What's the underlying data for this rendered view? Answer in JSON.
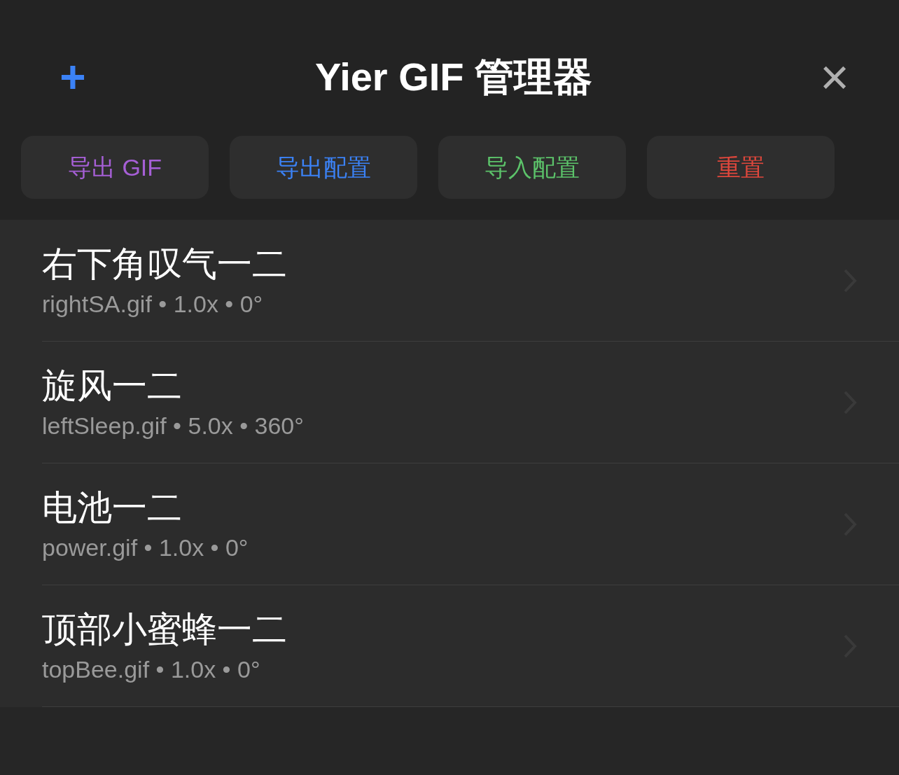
{
  "header": {
    "add_button": "+",
    "title": "Yier GIF 管理器",
    "close_button": "×"
  },
  "actions": [
    {
      "label": "导出 GIF",
      "color": "#a65fd6"
    },
    {
      "label": "导出配置",
      "color": "#3b82f6"
    },
    {
      "label": "导入配置",
      "color": "#5cc36a"
    },
    {
      "label": "重置",
      "color": "#e0473c"
    }
  ],
  "gifs": [
    {
      "name": "右下角叹气一二",
      "details": "rightSA.gif • 1.0x • 0°"
    },
    {
      "name": "旋风一二",
      "details": "leftSleep.gif • 5.0x • 360°"
    },
    {
      "name": "电池一二",
      "details": "power.gif • 1.0x • 0°"
    },
    {
      "name": "顶部小蜜蜂一二",
      "details": "topBee.gif • 1.0x • 0°"
    }
  ]
}
